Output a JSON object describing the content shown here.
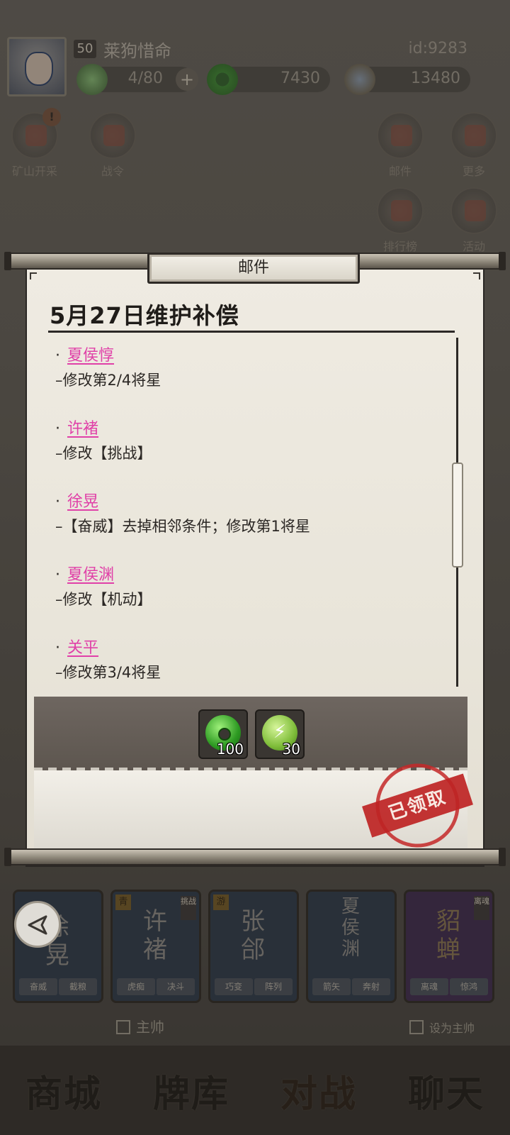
{
  "player": {
    "level": "50",
    "name": "莱狗惜命",
    "id": "id:9283",
    "energy": "4/80",
    "jade": "7430",
    "coins": "13480"
  },
  "side_buttons": {
    "mining": "矿山开采",
    "battlepass": "战令",
    "mail": "邮件",
    "more": "更多",
    "ranking": "排行榜",
    "events": "活动",
    "badge": "!"
  },
  "mail": {
    "window_title": "邮件",
    "subject": "5月27日维护补偿",
    "entries": [
      {
        "hero": "夏侯惇",
        "desc": "–修改第2/4将星"
      },
      {
        "hero": "许褚",
        "desc": "–修改【挑战】"
      },
      {
        "hero": "徐晃",
        "desc": "–【奋威】去掉相邻条件；修改第1将星"
      },
      {
        "hero": "夏侯渊",
        "desc": "–修改【机动】"
      },
      {
        "hero": "关平",
        "desc": "–修改第3/4将星"
      }
    ],
    "rewards": [
      {
        "icon": "jade-coin-icon",
        "count": "100"
      },
      {
        "icon": "energy-icon",
        "count": "30"
      }
    ],
    "claimed_stamp": "已领取",
    "bullet": "·"
  },
  "cards": [
    {
      "name": "徐\n晃",
      "skills": [
        "奋威",
        "截粮"
      ],
      "tag": ""
    },
    {
      "name": "许\n褚",
      "skills": [
        "虎痴",
        "决斗"
      ],
      "tag": "青"
    },
    {
      "name": "张\n郃",
      "skills": [
        "巧变",
        "阵列"
      ],
      "tag": "游"
    },
    {
      "name": "夏\n侯\n渊",
      "skills": [
        "箭矢",
        "奔射"
      ],
      "tag": ""
    },
    {
      "name": "貂\n蝉",
      "skills": [
        "离魂",
        "惊鸿"
      ],
      "tag": ""
    }
  ],
  "card_side_tags": {
    "xuchu": "挑战",
    "diaochan": "离魂"
  },
  "checks": {
    "left": "主帅",
    "right": "设为主帅"
  },
  "nav": {
    "shop": "商城",
    "deck": "牌库",
    "battle": "对战",
    "chat": "聊天"
  }
}
